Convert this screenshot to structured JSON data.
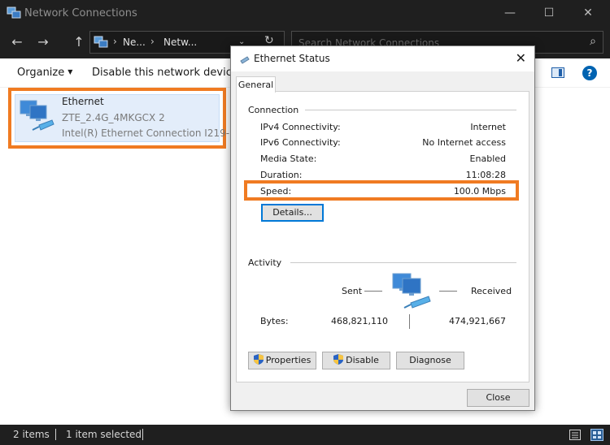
{
  "window": {
    "title": "Network Connections",
    "minimize": "—",
    "maximize": "☐",
    "close": "✕"
  },
  "address": {
    "crumbs": [
      "Ne...",
      "Netw..."
    ],
    "search_placeholder": "Search Network Connections"
  },
  "toolbar": {
    "organize": "Organize",
    "disable": "Disable this network device"
  },
  "item": {
    "name": "Ethernet",
    "network": "ZTE_2.4G_4MKGCX 2",
    "adapter": "Intel(R) Ethernet Connection I219-..."
  },
  "statusbar": {
    "count": "2 items",
    "selected": "1 item selected"
  },
  "dialog": {
    "title": "Ethernet Status",
    "tab": "General",
    "connection": {
      "heading": "Connection",
      "rows": [
        {
          "label": "IPv4 Connectivity:",
          "value": "Internet"
        },
        {
          "label": "IPv6 Connectivity:",
          "value": "No Internet access"
        },
        {
          "label": "Media State:",
          "value": "Enabled"
        },
        {
          "label": "Duration:",
          "value": "11:08:28"
        },
        {
          "label": "Speed:",
          "value": "100.0 Mbps"
        }
      ],
      "details_button": "Details..."
    },
    "activity": {
      "heading": "Activity",
      "sent_label": "Sent",
      "received_label": "Received",
      "bytes_label": "Bytes:",
      "bytes_sent": "468,821,110",
      "bytes_received": "474,921,667"
    },
    "buttons": {
      "properties": "Properties",
      "disable": "Disable",
      "diagnose": "Diagnose",
      "close": "Close"
    }
  },
  "colors": {
    "highlight": "#f07b22",
    "dark_chrome": "#1f1f1f",
    "accent": "#0078d7"
  }
}
